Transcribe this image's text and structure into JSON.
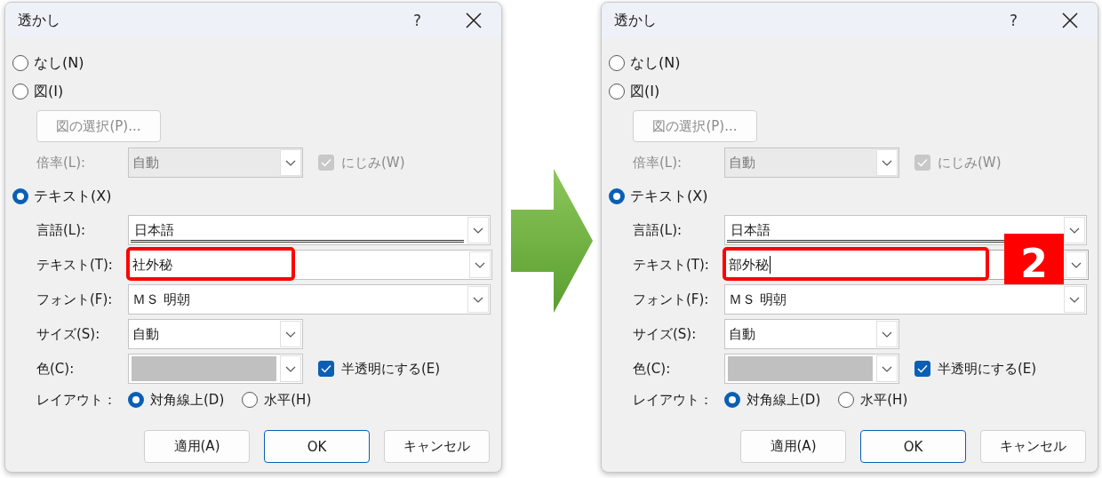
{
  "dialogs": [
    {
      "title": "透かし",
      "help": "?",
      "none_option": {
        "label": "なし(N)",
        "selected": false
      },
      "picture_option": {
        "label": "図(I)",
        "selected": false
      },
      "picture_button": {
        "label": "図の選択(P)...",
        "disabled": true
      },
      "scale": {
        "label": "倍率(L):",
        "value": "自動",
        "disabled": true
      },
      "washout": {
        "label": "にじみ(W)",
        "checked": true,
        "disabled": true
      },
      "text_option": {
        "label": "テキスト(X)",
        "selected": true
      },
      "language": {
        "label": "言語(L):",
        "value": "日本語"
      },
      "text": {
        "label": "テキスト(T):",
        "value": "社外秘",
        "highlighted": true,
        "focused": false
      },
      "font": {
        "label": "フォント(F):",
        "value": "ＭＳ 明朝"
      },
      "size": {
        "label": "サイズ(S):",
        "value": "自動"
      },
      "color": {
        "label": "色(C):"
      },
      "semitransparent": {
        "label": "半透明にする(E)",
        "checked": true
      },
      "layout": {
        "label": "レイアウト：",
        "options": [
          {
            "label": "対角線上(D)",
            "selected": true
          },
          {
            "label": "水平(H)",
            "selected": false
          }
        ]
      },
      "buttons": [
        {
          "label": "適用(A)",
          "default": false
        },
        {
          "label": "OK",
          "default": true
        },
        {
          "label": "キャンセル",
          "default": false
        }
      ]
    },
    {
      "title": "透かし",
      "help": "?",
      "none_option": {
        "label": "なし(N)",
        "selected": false
      },
      "picture_option": {
        "label": "図(I)",
        "selected": false
      },
      "picture_button": {
        "label": "図の選択(P)...",
        "disabled": true
      },
      "scale": {
        "label": "倍率(L):",
        "value": "自動",
        "disabled": true
      },
      "washout": {
        "label": "にじみ(W)",
        "checked": true,
        "disabled": true
      },
      "text_option": {
        "label": "テキスト(X)",
        "selected": true
      },
      "language": {
        "label": "言語(L):",
        "value": "日本語"
      },
      "text": {
        "label": "テキスト(T):",
        "value": "部外秘",
        "highlighted": true,
        "focused": true
      },
      "font": {
        "label": "フォント(F):",
        "value": "ＭＳ 明朝"
      },
      "size": {
        "label": "サイズ(S):",
        "value": "自動"
      },
      "color": {
        "label": "色(C):"
      },
      "semitransparent": {
        "label": "半透明にする(E)",
        "checked": true
      },
      "layout": {
        "label": "レイアウト：",
        "options": [
          {
            "label": "対角線上(D)",
            "selected": true
          },
          {
            "label": "水平(H)",
            "selected": false
          }
        ]
      },
      "buttons": [
        {
          "label": "適用(A)",
          "default": false
        },
        {
          "label": "OK",
          "default": true
        },
        {
          "label": "キャンセル",
          "default": false
        }
      ],
      "badge": "2"
    }
  ]
}
